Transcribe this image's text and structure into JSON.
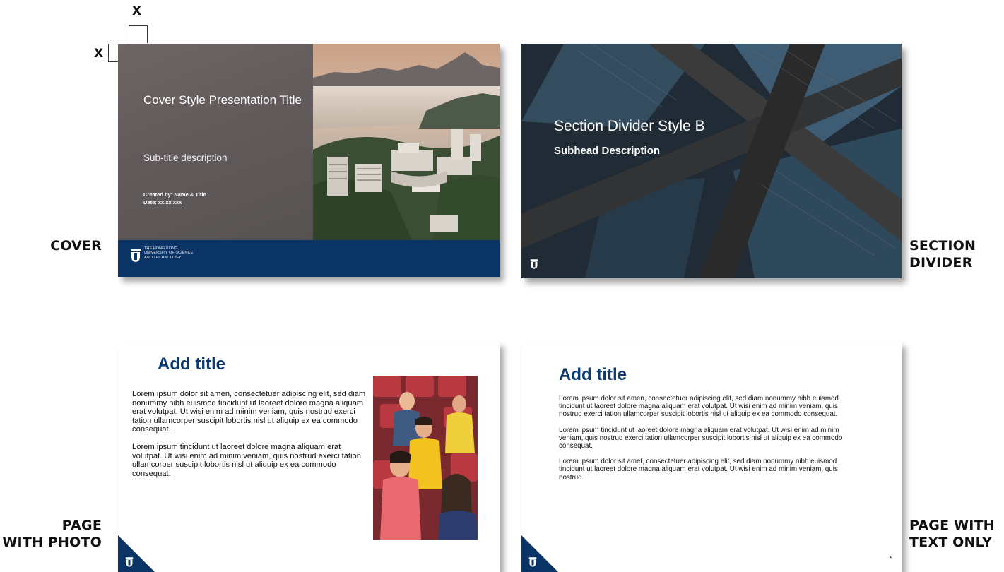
{
  "annotations": {
    "x_top": "X",
    "x_left": "X",
    "cover": "COVER",
    "section_divider": [
      "SECTION",
      "DIVIDER"
    ],
    "page_with_photo": [
      "PAGE",
      "WITH PHOTO"
    ],
    "page_with_text_only": [
      "PAGE WITH",
      "TEXT ONLY"
    ]
  },
  "cover_slide": {
    "title": "Cover Style Presentation Title",
    "subtitle": "Sub-title description",
    "created_by": "Created by: Name & Title",
    "date_label": "Date: ",
    "date_value": "xx.xx.xxx",
    "university": [
      "THE HONG KONG",
      "UNIVERSITY OF SCIENCE",
      "AND TECHNOLOGY"
    ]
  },
  "divider_slide": {
    "title": "Section Divider Style B",
    "subhead": "Subhead Description"
  },
  "photo_page": {
    "title": "Add title",
    "paragraphs": [
      "Lorem ipsum dolor sit amen, consectetuer adipiscing elit, sed diam nonummy nibh euismod tincidunt ut laoreet dolore magna aliquam erat volutpat. Ut wisi enim ad minim veniam, quis nostrud exerci tation ullamcorper suscipit lobortis nisl ut aliquip ex ea commodo consequat.",
      "Lorem ipsum tincidunt ut laoreet dolore magna aliquam erat volutpat. Ut wisi enim ad minim veniam, quis nostrud exerci tation ullamcorper suscipit lobortis nisl ut aliquip ex ea commodo consequat."
    ]
  },
  "text_page": {
    "title": "Add title",
    "paragraphs": [
      "Lorem ipsum dolor sit amen, consectetuer adipiscing elit, sed diam nonummy nibh euismod tincidunt ut laoreet dolore magna aliquam erat volutpat. Ut wisi enim ad minim veniam, quis nostrud exerci tation ullamcorper suscipit lobortis nisl ut aliquip ex ea commodo consequat.",
      "Lorem ipsum tincidunt ut laoreet dolore magna aliquam erat volutpat. Ut wisi enim ad minim veniam, quis nostrud exerci tation ullamcorper suscipit lobortis nisl ut aliquip ex ea commodo consequat.",
      "Lorem ipsum dolor sit amet, consectetuer adipiscing elit, sed diam nonummy nibh euismod tincidunt ut laoreet dolore magna aliquam erat volutpat. Ut wisi enim ad minim veniam, quis nostrud."
    ],
    "page_number": "5"
  },
  "colors": {
    "brand_navy": "#0b3466",
    "title_blue": "#0d3a6e",
    "cover_grey": "#625b5b"
  }
}
